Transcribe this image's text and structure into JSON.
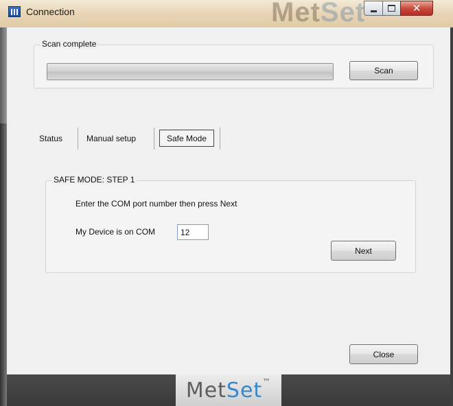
{
  "window": {
    "title": "Connection",
    "watermark_brand_part1": "Met",
    "watermark_brand_part2": "Set"
  },
  "scan_group": {
    "legend": "Scan complete",
    "progress_fraction": 1.0,
    "scan_button_label": "Scan"
  },
  "tabs": [
    {
      "label": "Status",
      "selected": false
    },
    {
      "label": "Manual setup",
      "selected": false
    },
    {
      "label": "Safe Mode",
      "selected": true
    }
  ],
  "safe_mode_group": {
    "legend": "SAFE MODE: STEP 1",
    "instruction": "Enter the COM port number then press Next",
    "com_label": "My Device is on COM",
    "com_value": "12",
    "next_button_label": "Next"
  },
  "close_button_label": "Close",
  "footer": {
    "logo_part1": "Met",
    "logo_part2": "Set",
    "logo_mark": "™"
  },
  "colors": {
    "footer_bg": "#3a3a3a",
    "logo_accent": "#3b86c6",
    "close_btn_red": "#c7473a"
  }
}
